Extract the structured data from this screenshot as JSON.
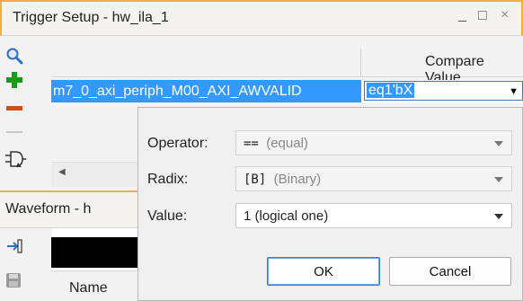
{
  "window": {
    "title": "Trigger Setup - hw_ila_1",
    "minimize_glyph": "_",
    "maximize_glyph": "□",
    "close_glyph": "×"
  },
  "toolbar": {
    "icons": [
      "search-icon",
      "add-icon",
      "remove-icon",
      "combine-icon"
    ]
  },
  "table": {
    "compare_value_header": "Compare Value",
    "selected_row": {
      "probe_name": "m7_0_axi_periph_M00_AXI_AWVALID",
      "compare_value": "eq1'bX"
    }
  },
  "waveform": {
    "title": "Waveform - h",
    "name_header": "Name"
  },
  "popup": {
    "operator_label": "Operator:",
    "operator_code": "==",
    "operator_desc": "(equal)",
    "radix_label": "Radix:",
    "radix_code": "[B]",
    "radix_desc": "(Binary)",
    "value_label": "Value:",
    "value_text": "1 (logical one)",
    "ok_label": "OK",
    "cancel_label": "Cancel"
  },
  "colors": {
    "accent_border": "#f0b040",
    "selection": "#3399ff",
    "add_green": "#1a9a1a",
    "remove_orange": "#d05010"
  }
}
